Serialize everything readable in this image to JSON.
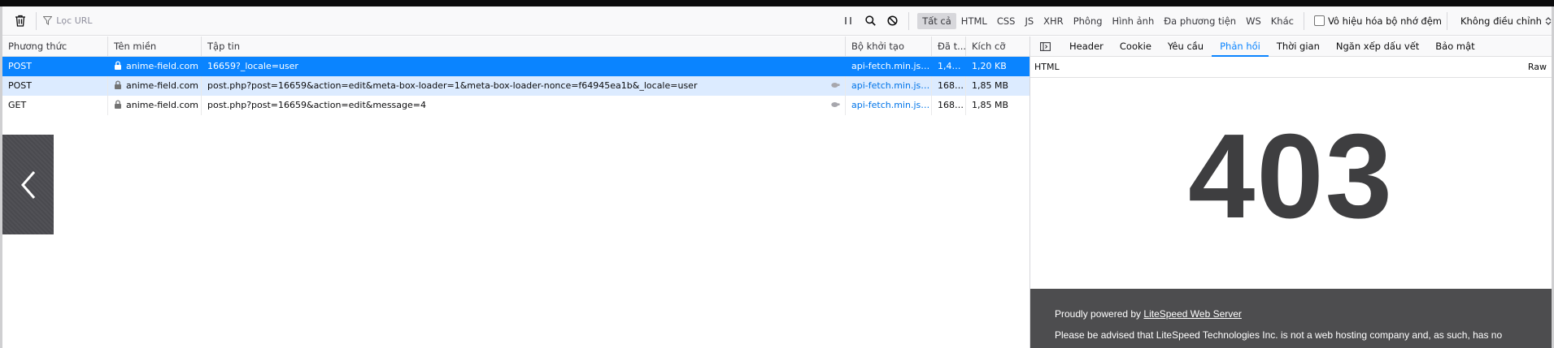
{
  "toolbar": {
    "filter_placeholder": "Lọc URL",
    "types": [
      "Tất cả",
      "HTML",
      "CSS",
      "JS",
      "XHR",
      "Phông",
      "Hình ảnh",
      "Đa phương tiện",
      "WS",
      "Khác"
    ],
    "active_type": "Tất cả",
    "disable_cache_label": "Vô hiệu hóa bộ nhớ đệm",
    "throttle_label": "Không điều chỉnh"
  },
  "table": {
    "headers": [
      "Phương thức",
      "Tên miền",
      "Tập tin",
      "Bộ khởi tạo",
      "Đã t...",
      "Kích cỡ"
    ],
    "rows": [
      {
        "method": "POST",
        "domain": "anime-field.com",
        "file": "16659?_locale=user",
        "cause": "api-fetch.min.js:...",
        "transferred": "1,46...",
        "size": "1,20 KB"
      },
      {
        "method": "POST",
        "domain": "anime-field.com",
        "file": "post.php?post=16659&action=edit&meta-box-loader=1&meta-box-loader-nonce=f64945ea1b&_locale=user",
        "cause": "api-fetch.min.js:...",
        "transferred": "168,...",
        "size": "1,85 MB"
      },
      {
        "method": "GET",
        "domain": "anime-field.com",
        "file": "post.php?post=16659&action=edit&message=4",
        "cause": "api-fetch.min.js:...",
        "transferred": "168,...",
        "size": "1,85 MB"
      }
    ]
  },
  "panel": {
    "tabs": [
      "Header",
      "Cookie",
      "Yêu cầu",
      "Phản hồi",
      "Thời gian",
      "Ngăn xếp dấu vết",
      "Bảo mật"
    ],
    "active_tab": "Phản hồi",
    "resp_label": "HTML",
    "raw_label": "Raw",
    "error_code": "403",
    "footer_prefix": "Proudly powered by ",
    "footer_link": "LiteSpeed Web Server",
    "footer_notice": "Please be advised that LiteSpeed Technologies Inc. is not a web hosting company and, as such, has no"
  },
  "colors": {
    "accent": "#0a84ff",
    "selected_row": "#0a84ff",
    "hover_row": "#dcebff",
    "error_footer": "#4d4d4f"
  }
}
